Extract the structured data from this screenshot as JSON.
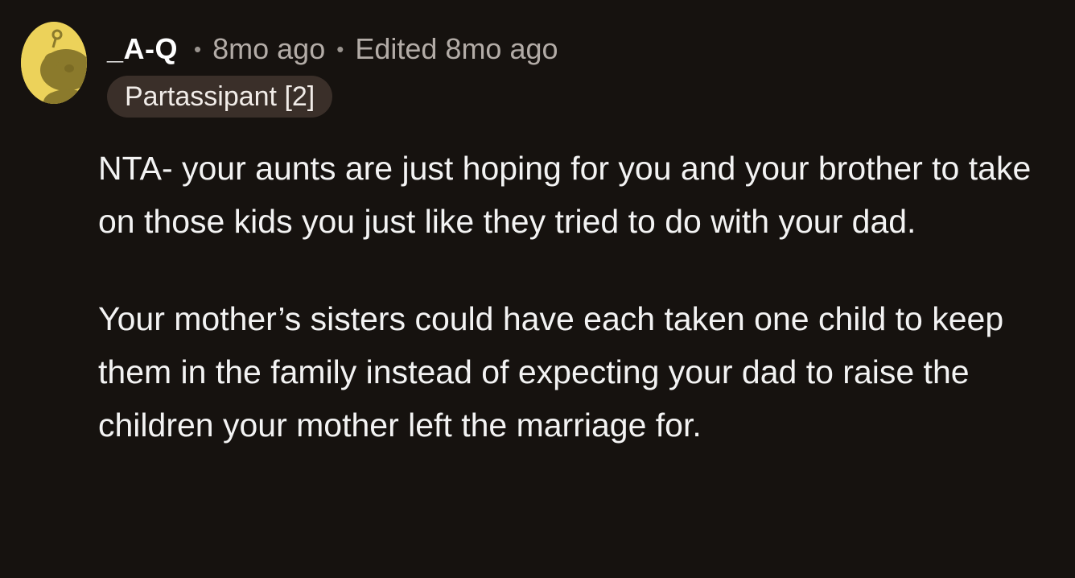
{
  "comment": {
    "author": "_A-Q",
    "posted": "8mo ago",
    "edited": "Edited 8mo ago",
    "flair": "Partassipant [2]",
    "paragraphs": [
      "NTA- your aunts are just hoping for you and your brother to take on those kids you just like they tried to do with your dad.",
      "Your mother’s sisters could have each taken one child to keep them in the family instead of expecting your dad to raise the children your mother left the marriage for."
    ]
  },
  "avatar": {
    "icon": "snoo-avatar-icon",
    "background": "#ecd25a",
    "figure": "#8b7a2c"
  },
  "colors": {
    "background": "#16120f",
    "username": "#ffffff",
    "meta": "#b3aca7",
    "flair_bg": "#3a2f29",
    "body_text": "#f3f3f3"
  }
}
